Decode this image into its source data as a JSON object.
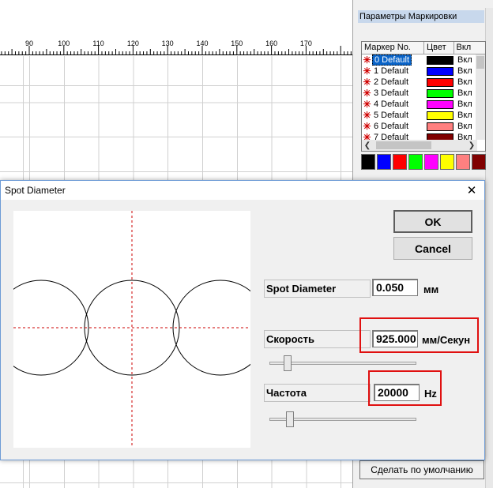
{
  "ruler": {
    "ticks": [
      "90",
      "100",
      "110",
      "120",
      "130",
      "140",
      "150",
      "160",
      "170"
    ]
  },
  "panel": {
    "title": "Параметры Маркировки",
    "table": {
      "headers": [
        "Маркер No.",
        "Цвет",
        "Вкл"
      ],
      "rows": [
        {
          "name": "0 Default",
          "color": "#000000",
          "on": "Вкл",
          "selected": true
        },
        {
          "name": "1 Default",
          "color": "#0000ff",
          "on": "Вкл"
        },
        {
          "name": "2 Default",
          "color": "#ff0000",
          "on": "Вкл"
        },
        {
          "name": "3 Default",
          "color": "#00ff00",
          "on": "Вкл"
        },
        {
          "name": "4 Default",
          "color": "#ff00ff",
          "on": "Вкл"
        },
        {
          "name": "5 Default",
          "color": "#ffff00",
          "on": "Вкл"
        },
        {
          "name": "6 Default",
          "color": "#ff8080",
          "on": "Вкл"
        },
        {
          "name": "7 Default",
          "color": "#800000",
          "on": "Вкл"
        }
      ]
    },
    "palette": [
      "#000000",
      "#0000ff",
      "#ff0000",
      "#00ff00",
      "#ff00ff",
      "#ffff00",
      "#ff8080",
      "#800000"
    ],
    "default_button": "Сделать по умолчанию"
  },
  "dialog": {
    "title": "Spot Diameter",
    "close_icon": "close-icon",
    "ok": "OK",
    "cancel": "Cancel",
    "spot_diameter": {
      "label": "Spot Diameter",
      "value": "0.050",
      "unit": "мм"
    },
    "speed": {
      "label": "Скорость",
      "value": "925.000",
      "unit": "мм/Секун",
      "slider_fraction": 0.1
    },
    "frequency": {
      "label": "Частота",
      "value": "20000",
      "unit": "Hz",
      "slider_fraction": 0.12
    }
  },
  "colors": {
    "highlight": "#e01010",
    "crosshair": "#cc0000"
  }
}
